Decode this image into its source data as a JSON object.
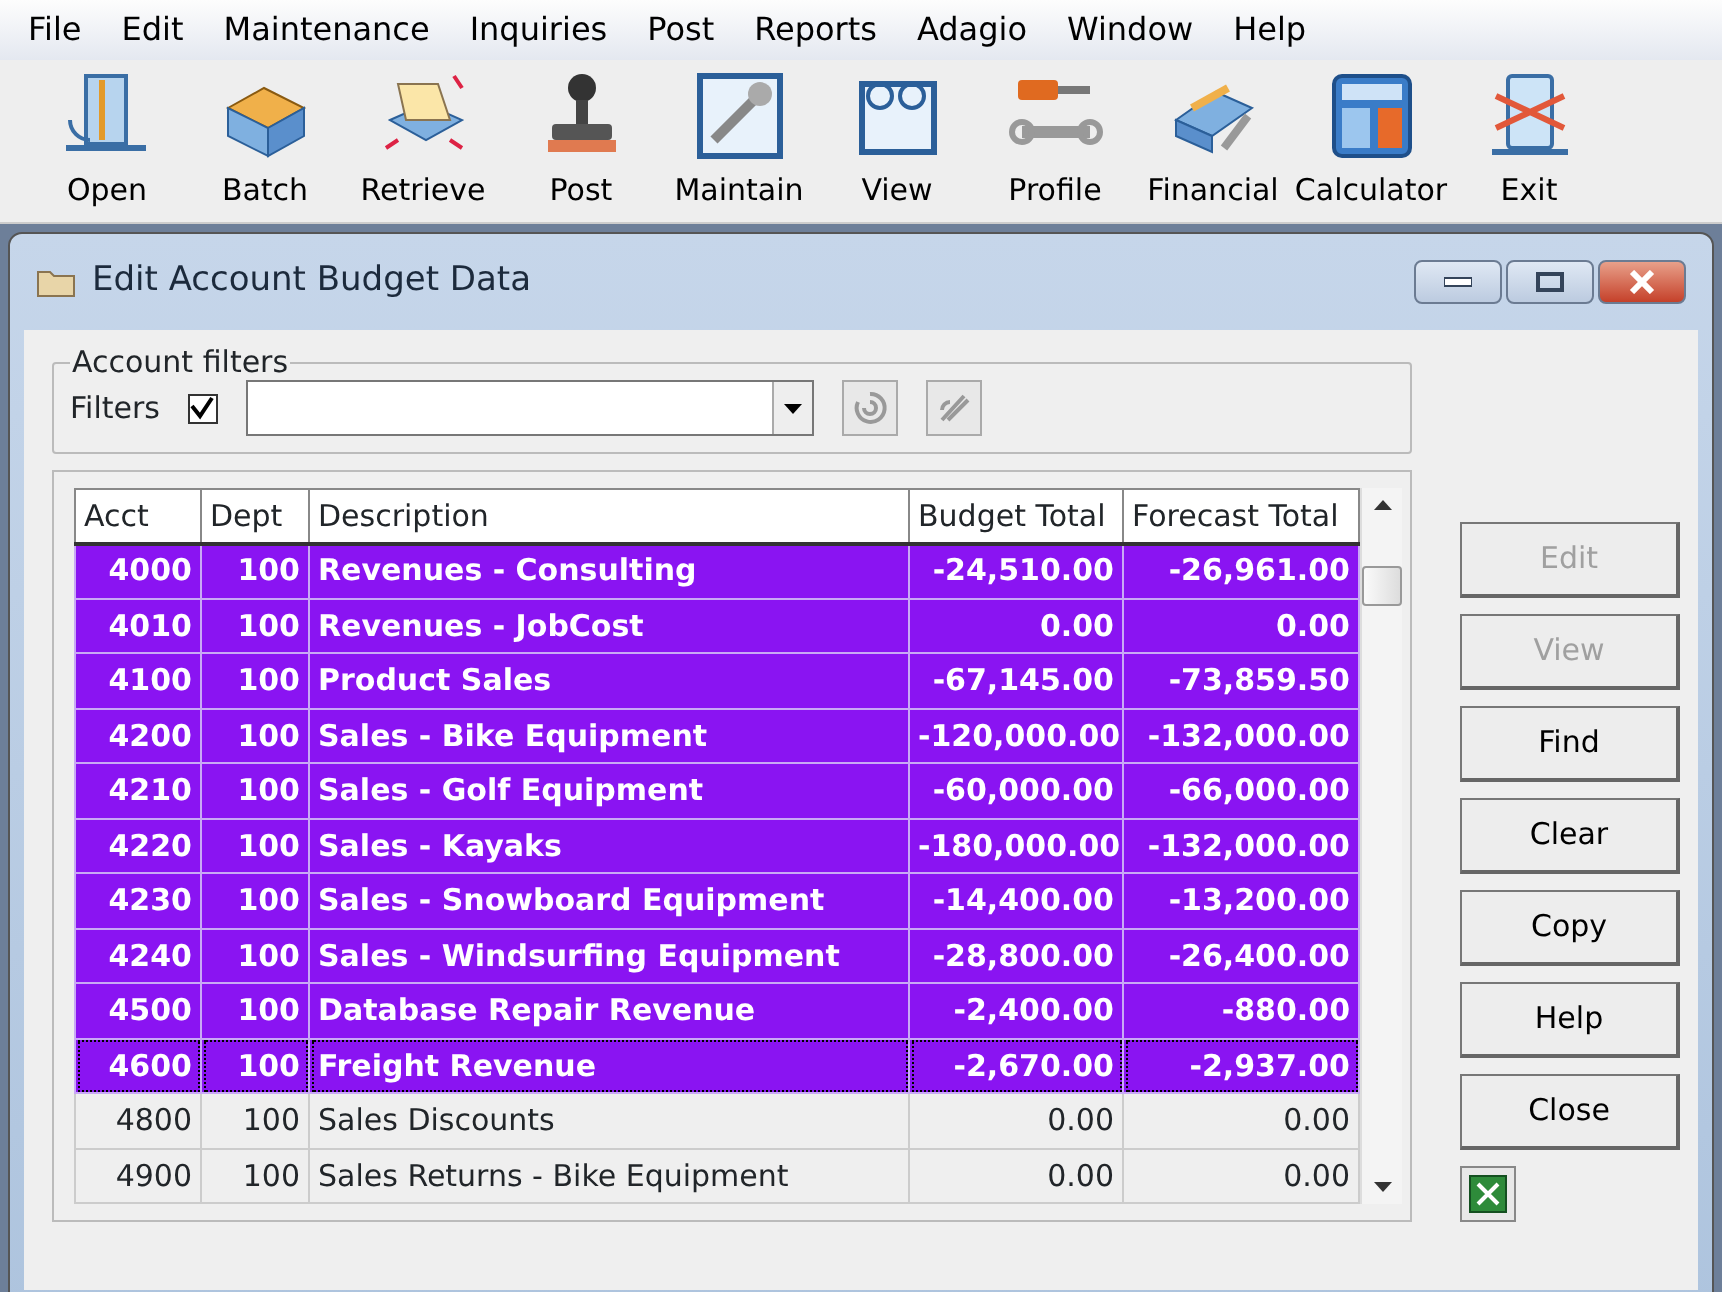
{
  "menu_bar": [
    "File",
    "Edit",
    "Maintenance",
    "Inquiries",
    "Post",
    "Reports",
    "Adagio",
    "Window",
    "Help"
  ],
  "toolbar": [
    {
      "label": "Open",
      "kind": "door"
    },
    {
      "label": "Batch",
      "kind": "stack"
    },
    {
      "label": "Retrieve",
      "kind": "retrieve"
    },
    {
      "label": "Post",
      "kind": "stamp"
    },
    {
      "label": "Maintain",
      "kind": "wrench"
    },
    {
      "label": "View",
      "kind": "glasses"
    },
    {
      "label": "Profile",
      "kind": "tools"
    },
    {
      "label": "Financial",
      "kind": "books"
    },
    {
      "label": "Calculator",
      "kind": "calc"
    },
    {
      "label": "Exit",
      "kind": "exit"
    }
  ],
  "window": {
    "title": "Edit Account Budget Data"
  },
  "account_filters": {
    "legend": "Account filters",
    "filters_label": "Filters",
    "filters_checked": true
  },
  "table": {
    "columns": [
      "Acct",
      "Dept",
      "Description",
      "Budget Total",
      "Forecast Total"
    ],
    "rows": [
      {
        "acct": "4000",
        "dept": "100",
        "description": "Revenues - Consulting",
        "budget": "-24,510.00",
        "forecast": "-26,961.00",
        "selected": true
      },
      {
        "acct": "4010",
        "dept": "100",
        "description": "Revenues - JobCost",
        "budget": "0.00",
        "forecast": "0.00",
        "selected": true
      },
      {
        "acct": "4100",
        "dept": "100",
        "description": "Product Sales",
        "budget": "-67,145.00",
        "forecast": "-73,859.50",
        "selected": true
      },
      {
        "acct": "4200",
        "dept": "100",
        "description": "Sales - Bike Equipment",
        "budget": "-120,000.00",
        "forecast": "-132,000.00",
        "selected": true
      },
      {
        "acct": "4210",
        "dept": "100",
        "description": "Sales - Golf Equipment",
        "budget": "-60,000.00",
        "forecast": "-66,000.00",
        "selected": true
      },
      {
        "acct": "4220",
        "dept": "100",
        "description": "Sales - Kayaks",
        "budget": "-180,000.00",
        "forecast": "-132,000.00",
        "selected": true
      },
      {
        "acct": "4230",
        "dept": "100",
        "description": "Sales - Snowboard Equipment",
        "budget": "-14,400.00",
        "forecast": "-13,200.00",
        "selected": true
      },
      {
        "acct": "4240",
        "dept": "100",
        "description": "Sales - Windsurfing Equipment",
        "budget": "-28,800.00",
        "forecast": "-26,400.00",
        "selected": true
      },
      {
        "acct": "4500",
        "dept": "100",
        "description": "Database Repair Revenue",
        "budget": "-2,400.00",
        "forecast": "-880.00",
        "selected": true
      },
      {
        "acct": "4600",
        "dept": "100",
        "description": "Freight Revenue",
        "budget": "-2,670.00",
        "forecast": "-2,937.00",
        "selected": true
      },
      {
        "acct": "4800",
        "dept": "100",
        "description": "Sales Discounts",
        "budget": "0.00",
        "forecast": "0.00",
        "selected": false
      },
      {
        "acct": "4900",
        "dept": "100",
        "description": "Sales Returns - Bike Equipment",
        "budget": "0.00",
        "forecast": "0.00",
        "selected": false
      }
    ]
  },
  "buttons": [
    {
      "label": "Edit",
      "disabled": true
    },
    {
      "label": "View",
      "disabled": true
    },
    {
      "label": "Find",
      "disabled": false
    },
    {
      "label": "Clear",
      "disabled": false
    },
    {
      "label": "Copy",
      "disabled": false
    },
    {
      "label": "Help",
      "disabled": false
    },
    {
      "label": "Close",
      "disabled": false
    }
  ]
}
